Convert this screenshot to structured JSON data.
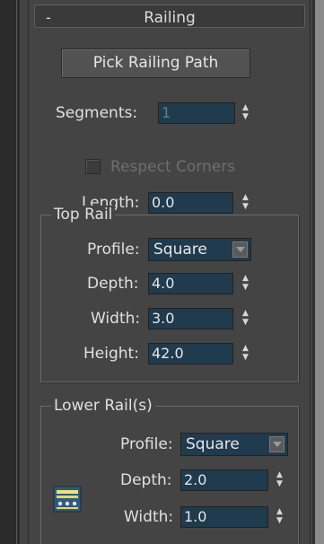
{
  "rollout": {
    "title": "Railing",
    "toggle": "-"
  },
  "pick_button": "Pick Railing Path",
  "segments": {
    "label": "Segments:",
    "value": "1"
  },
  "respect_corners": {
    "label": "Respect Corners",
    "checked": false
  },
  "length": {
    "label": "Length:",
    "value": "0.0"
  },
  "top_rail": {
    "title": "Top Rail",
    "profile_label": "Profile:",
    "profile_value": "Square",
    "depth_label": "Depth:",
    "depth_value": "4.0",
    "width_label": "Width:",
    "width_value": "3.0",
    "height_label": "Height:",
    "height_value": "42.0"
  },
  "lower_rails": {
    "title": "Lower Rail(s)",
    "profile_label": "Profile:",
    "profile_value": "Square",
    "depth_label": "Depth:",
    "depth_value": "2.0",
    "width_label": "Width:",
    "width_value": "1.0"
  },
  "icons": {
    "spinner": "spinner-up-down",
    "dropdown": "dropdown-arrow",
    "lower_rail": "lower-rail-spacing-icon"
  }
}
